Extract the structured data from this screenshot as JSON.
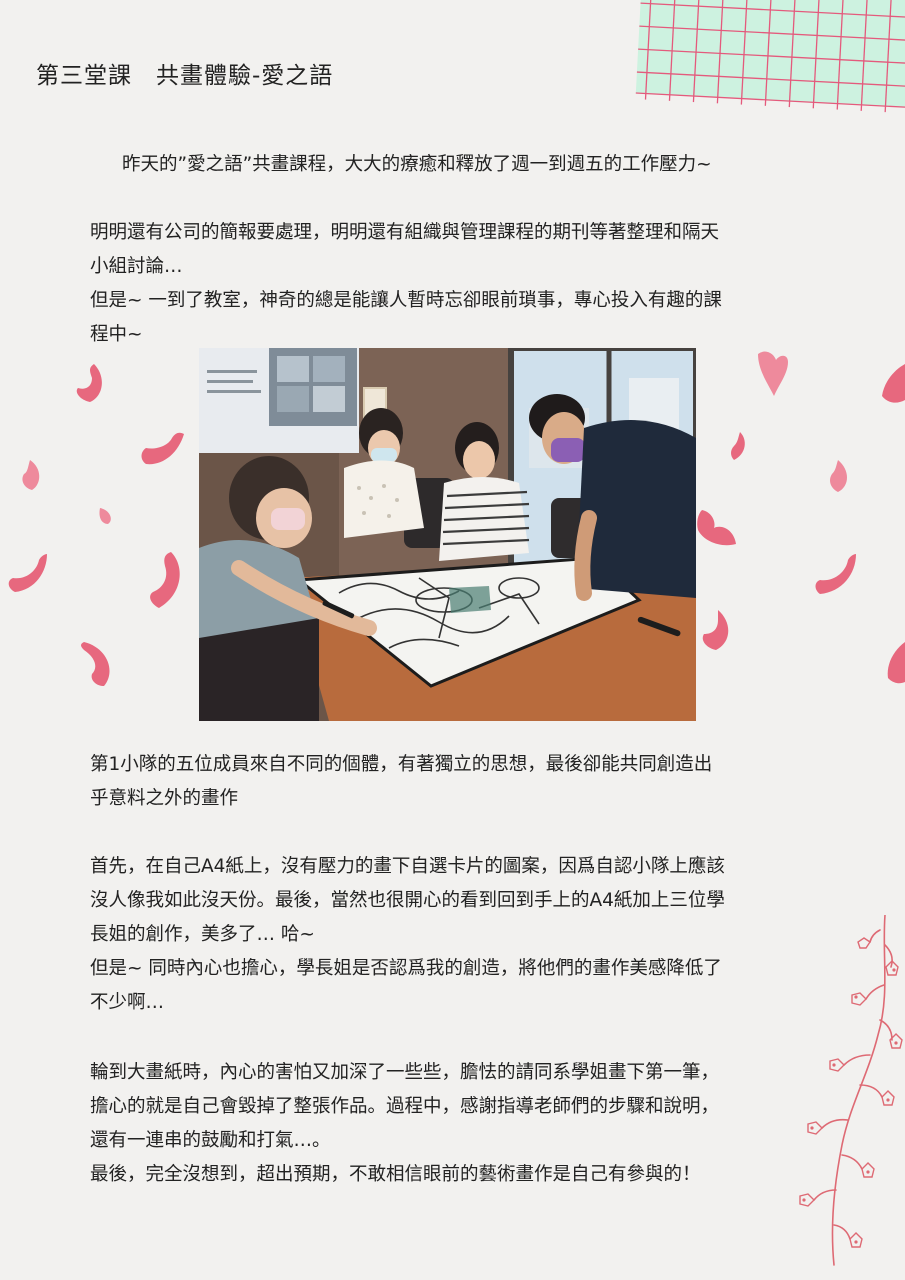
{
  "title": "第三堂課　共畫體驗-愛之語",
  "intro": "昨天的”愛之語”共畫課程，大大的療癒和釋放了週一到週五的工作壓力~",
  "paragraphs": [
    {
      "lines": [
        "明明還有公司的簡報要處理，明明還有組織與管理課程的期刊等著整理和隔天",
        "小組討論…",
        "但是~ 一到了教室，神奇的總是能讓人暫時忘卻眼前瑣事，專心投入有趣的課",
        "程中~"
      ]
    },
    {
      "lines": [
        "第1小隊的五位成員來自不同的個體，有著獨立的思想，最後卻能共同創造出",
        "乎意料之外的畫作"
      ]
    },
    {
      "lines": [
        "首先，在自己A4紙上，沒有壓力的畫下自選卡片的圖案，因爲自認小隊上應該",
        "沒人像我如此沒天份。最後，當然也很開心的看到回到手上的A4紙加上三位學",
        "長姐的創作，美多了… 哈~",
        "但是~ 同時內心也擔心，學長姐是否認爲我的創造，將他們的畫作美感降低了",
        "不少啊…"
      ]
    },
    {
      "lines": [
        "輪到大畫紙時，內心的害怕又加深了一些些，膽怯的請同系學姐畫下第一筆，",
        "擔心的就是自己會毀掉了整張作品。過程中，感謝指導老師們的步驟和說明，",
        "還有一連串的鼓勵和打氣…。",
        "最後，完全沒想到，超出預期，不敢相信眼前的藝術畫作是自己有參與的！"
      ]
    }
  ],
  "colors": {
    "background": "#f2f1ef",
    "grid_fill": "#cdf2e0",
    "grid_line": "#e45a7c",
    "petal": "#e7687e",
    "vine": "#de6a74"
  },
  "decorations": [
    "grid-paper",
    "falling-petals",
    "flower-vine"
  ]
}
